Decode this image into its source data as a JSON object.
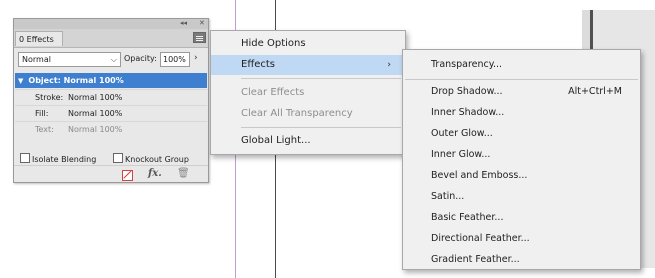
{
  "panel": {
    "tab_label": "0 Effects",
    "blend_mode": "Normal",
    "opacity_label": "Opacity:",
    "opacity_value": "100%",
    "object_row": "Object: Normal 100%",
    "rows": [
      {
        "key": "Stroke:",
        "value": "Normal 100%"
      },
      {
        "key": "Fill:",
        "value": "Normal 100%"
      },
      {
        "key": "Text:",
        "value": "Normal 100%"
      }
    ],
    "isolate_label": "Isolate Blending",
    "knockout_label": "Knockout Group",
    "fx_label": "fx."
  },
  "menu1": {
    "hide_options": "Hide Options",
    "effects": "Effects",
    "clear_effects": "Clear Effects",
    "clear_all_transparency": "Clear All Transparency",
    "global_light": "Global Light..."
  },
  "menu2": {
    "transparency": "Transparency...",
    "drop_shadow": "Drop Shadow...",
    "drop_shadow_shortcut": "Alt+Ctrl+M",
    "inner_shadow": "Inner Shadow...",
    "outer_glow": "Outer Glow...",
    "inner_glow": "Inner Glow...",
    "bevel_emboss": "Bevel and Emboss...",
    "satin": "Satin...",
    "basic_feather": "Basic Feather...",
    "directional_feather": "Directional Feather...",
    "gradient_feather": "Gradient Feather..."
  },
  "colors": {
    "selection_blue": "#3f7fcf",
    "menu_highlight": "#bfd8f3"
  }
}
